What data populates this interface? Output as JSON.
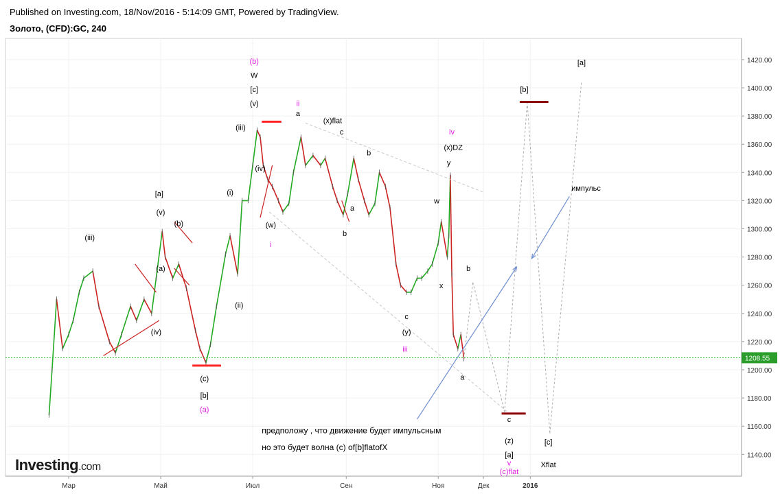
{
  "header": {
    "published": "Published on Investing.com, 18/Nov/2016 - 5:14:09 GMT, Powered by TradingView.",
    "symbol": "Золото, (CFD):GC, 240"
  },
  "logo": {
    "name": "Investing",
    "suffix": ".com"
  },
  "chart_data": {
    "type": "line",
    "ylim": [
      1130,
      1430
    ],
    "y_ticks": [
      1140,
      1160,
      1180,
      1200,
      1220,
      1240,
      1260,
      1280,
      1300,
      1320,
      1340,
      1360,
      1380,
      1400,
      1420
    ],
    "x_ticks": [
      "Мар",
      "Май",
      "Июл",
      "Сен",
      "Ноя",
      "Дек",
      "2016"
    ],
    "current_price": "1208.55",
    "colors": {
      "up": "#22aa22",
      "down": "#cc2222",
      "price_line": "#22bb22",
      "support": "#ff2222",
      "target": "#8b0000",
      "arrow": "#6f8fcf",
      "projection": "#aaaaaa",
      "magenta": "#e020e0"
    },
    "price_series": [
      {
        "x": "2016-02-17",
        "y": 1168
      },
      {
        "x": "2016-02-19",
        "y": 1200
      },
      {
        "x": "2016-02-22",
        "y": 1250
      },
      {
        "x": "2016-02-26",
        "y": 1215
      },
      {
        "x": "2016-03-01",
        "y": 1225
      },
      {
        "x": "2016-03-04",
        "y": 1235
      },
      {
        "x": "2016-03-08",
        "y": 1255
      },
      {
        "x": "2016-03-11",
        "y": 1265
      },
      {
        "x": "2016-03-17",
        "y": 1270
      },
      {
        "x": "2016-03-21",
        "y": 1245
      },
      {
        "x": "2016-03-28",
        "y": 1220
      },
      {
        "x": "2016-04-01",
        "y": 1212
      },
      {
        "x": "2016-04-05",
        "y": 1225
      },
      {
        "x": "2016-04-11",
        "y": 1245
      },
      {
        "x": "2016-04-15",
        "y": 1235
      },
      {
        "x": "2016-04-20",
        "y": 1250
      },
      {
        "x": "2016-04-25",
        "y": 1240
      },
      {
        "x": "2016-04-28",
        "y": 1265
      },
      {
        "x": "2016-05-02",
        "y": 1298
      },
      {
        "x": "2016-05-04",
        "y": 1280
      },
      {
        "x": "2016-05-09",
        "y": 1265
      },
      {
        "x": "2016-05-13",
        "y": 1275
      },
      {
        "x": "2016-05-18",
        "y": 1258
      },
      {
        "x": "2016-05-24",
        "y": 1228
      },
      {
        "x": "2016-05-27",
        "y": 1215
      },
      {
        "x": "2016-05-31",
        "y": 1205
      },
      {
        "x": "2016-06-03",
        "y": 1218
      },
      {
        "x": "2016-06-07",
        "y": 1245
      },
      {
        "x": "2016-06-13",
        "y": 1282
      },
      {
        "x": "2016-06-16",
        "y": 1295
      },
      {
        "x": "2016-06-21",
        "y": 1268
      },
      {
        "x": "2016-06-24",
        "y": 1320
      },
      {
        "x": "2016-06-28",
        "y": 1320
      },
      {
        "x": "2016-07-01",
        "y": 1345
      },
      {
        "x": "2016-07-04",
        "y": 1370
      },
      {
        "x": "2016-07-06",
        "y": 1365
      },
      {
        "x": "2016-07-08",
        "y": 1345
      },
      {
        "x": "2016-07-11",
        "y": 1335
      },
      {
        "x": "2016-07-14",
        "y": 1330
      },
      {
        "x": "2016-07-18",
        "y": 1320
      },
      {
        "x": "2016-07-21",
        "y": 1312
      },
      {
        "x": "2016-07-25",
        "y": 1318
      },
      {
        "x": "2016-07-28",
        "y": 1340
      },
      {
        "x": "2016-08-02",
        "y": 1365
      },
      {
        "x": "2016-08-05",
        "y": 1345
      },
      {
        "x": "2016-08-10",
        "y": 1352
      },
      {
        "x": "2016-08-15",
        "y": 1345
      },
      {
        "x": "2016-08-18",
        "y": 1350
      },
      {
        "x": "2016-08-23",
        "y": 1330
      },
      {
        "x": "2016-08-26",
        "y": 1320
      },
      {
        "x": "2016-08-30",
        "y": 1310
      },
      {
        "x": "2016-09-02",
        "y": 1325
      },
      {
        "x": "2016-09-06",
        "y": 1350
      },
      {
        "x": "2016-09-09",
        "y": 1335
      },
      {
        "x": "2016-09-13",
        "y": 1320
      },
      {
        "x": "2016-09-16",
        "y": 1310
      },
      {
        "x": "2016-09-20",
        "y": 1318
      },
      {
        "x": "2016-09-23",
        "y": 1340
      },
      {
        "x": "2016-09-27",
        "y": 1330
      },
      {
        "x": "2016-09-30",
        "y": 1315
      },
      {
        "x": "2016-10-04",
        "y": 1275
      },
      {
        "x": "2016-10-07",
        "y": 1260
      },
      {
        "x": "2016-10-11",
        "y": 1255
      },
      {
        "x": "2016-10-14",
        "y": 1255
      },
      {
        "x": "2016-10-18",
        "y": 1265
      },
      {
        "x": "2016-10-21",
        "y": 1265
      },
      {
        "x": "2016-10-25",
        "y": 1270
      },
      {
        "x": "2016-10-28",
        "y": 1275
      },
      {
        "x": "2016-11-01",
        "y": 1290
      },
      {
        "x": "2016-11-03",
        "y": 1305
      },
      {
        "x": "2016-11-07",
        "y": 1280
      },
      {
        "x": "2016-11-08",
        "y": 1295
      },
      {
        "x": "2016-11-09",
        "y": 1338
      },
      {
        "x": "2016-11-10",
        "y": 1268
      },
      {
        "x": "2016-11-11",
        "y": 1225
      },
      {
        "x": "2016-11-14",
        "y": 1215
      },
      {
        "x": "2016-11-16",
        "y": 1225
      },
      {
        "x": "2016-11-18",
        "y": 1208
      }
    ],
    "projection": [
      {
        "x": "2016-11-18",
        "y": 1208
      },
      {
        "x": "2016-11-24",
        "y": 1262
      },
      {
        "x": "2016-12-15",
        "y": 1170
      },
      {
        "x": "2016-12-30",
        "y": 1390
      },
      {
        "x": "2017-01-14",
        "y": 1155
      },
      {
        "x": "2017-02-04",
        "y": 1405
      }
    ],
    "triangle_lines": [
      {
        "from": {
          "x": "2016-08-05",
          "y": 1375
        },
        "to": {
          "x": "2016-12-01",
          "y": 1326
        }
      },
      {
        "from": {
          "x": "2016-07-12",
          "y": 1312
        },
        "to": {
          "x": "2016-12-17",
          "y": 1170
        }
      }
    ],
    "support_lines": [
      {
        "x1": "2016-07-07",
        "x2": "2016-07-20",
        "y": 1376
      },
      {
        "x1": "2016-05-22",
        "x2": "2016-06-10",
        "y": 1203
      }
    ],
    "target_lines": [
      {
        "x1": "2016-12-13",
        "x2": "2016-12-29",
        "y": 1169
      },
      {
        "x1": "2016-12-25",
        "x2": "2017-01-13",
        "y": 1390
      }
    ],
    "red_wedges": [
      {
        "from": {
          "x": "2016-03-24",
          "y": 1210
        },
        "to": {
          "x": "2016-04-30",
          "y": 1235
        }
      },
      {
        "from": {
          "x": "2016-04-14",
          "y": 1275
        },
        "to": {
          "x": "2016-04-28",
          "y": 1255
        }
      },
      {
        "from": {
          "x": "2016-05-10",
          "y": 1305
        },
        "to": {
          "x": "2016-05-22",
          "y": 1290
        }
      },
      {
        "from": {
          "x": "2016-05-10",
          "y": 1272
        },
        "to": {
          "x": "2016-05-20",
          "y": 1260
        }
      },
      {
        "from": {
          "x": "2016-07-06",
          "y": 1308
        },
        "to": {
          "x": "2016-07-14",
          "y": 1345
        }
      },
      {
        "from": {
          "x": "2016-08-29",
          "y": 1320
        },
        "to": {
          "x": "2016-09-03",
          "y": 1305
        }
      }
    ],
    "arrows": [
      {
        "from": {
          "x": "2016-10-18",
          "y": 1165
        },
        "to": {
          "x": "2016-12-23",
          "y": 1273
        }
      },
      {
        "from": {
          "x": "2017-01-27",
          "y": 1323
        },
        "to": {
          "x": "2017-01-02",
          "y": 1279
        }
      }
    ],
    "annotations": [
      {
        "text": "(b)",
        "x": "2016-07-02",
        "y": 1417,
        "color": "#e020e0"
      },
      {
        "text": "W",
        "x": "2016-07-02",
        "y": 1407,
        "color": "#000000"
      },
      {
        "text": "[c]",
        "x": "2016-07-02",
        "y": 1397,
        "color": "#000000"
      },
      {
        "text": "(v)",
        "x": "2016-07-02",
        "y": 1387,
        "color": "#000000"
      },
      {
        "text": "ii",
        "x": "2016-07-31",
        "y": 1387,
        "color": "#e020e0"
      },
      {
        "text": "a",
        "x": "2016-07-31",
        "y": 1380,
        "color": "#000000"
      },
      {
        "text": "(x)flat",
        "x": "2016-08-23",
        "y": 1375,
        "color": "#000000"
      },
      {
        "text": "c",
        "x": "2016-08-29",
        "y": 1367,
        "color": "#000000"
      },
      {
        "text": "b",
        "x": "2016-09-16",
        "y": 1352,
        "color": "#000000"
      },
      {
        "text": "iv",
        "x": "2016-11-10",
        "y": 1367,
        "color": "#e020e0"
      },
      {
        "text": "(x)DZ",
        "x": "2016-11-11",
        "y": 1356,
        "color": "#000000"
      },
      {
        "text": "y",
        "x": "2016-11-08",
        "y": 1345,
        "color": "#000000"
      },
      {
        "text": "w",
        "x": "2016-10-31",
        "y": 1318,
        "color": "#000000"
      },
      {
        "text": "a",
        "x": "2016-09-05",
        "y": 1313,
        "color": "#000000"
      },
      {
        "text": "b",
        "x": "2016-08-31",
        "y": 1295,
        "color": "#000000"
      },
      {
        "text": "(iii)",
        "x": "2016-06-23",
        "y": 1370,
        "color": "#000000"
      },
      {
        "text": "(i)",
        "x": "2016-06-16",
        "y": 1324,
        "color": "#000000"
      },
      {
        "text": "(iv)",
        "x": "2016-07-06",
        "y": 1341,
        "color": "#000000"
      },
      {
        "text": "(w)",
        "x": "2016-07-13",
        "y": 1301,
        "color": "#000000"
      },
      {
        "text": "i",
        "x": "2016-07-13",
        "y": 1287,
        "color": "#e020e0"
      },
      {
        "text": "(ii)",
        "x": "2016-06-22",
        "y": 1244,
        "color": "#000000"
      },
      {
        "text": "[a]",
        "x": "2016-04-30",
        "y": 1323,
        "color": "#000000"
      },
      {
        "text": "(v)",
        "x": "2016-05-01",
        "y": 1310,
        "color": "#000000"
      },
      {
        "text": "(b)",
        "x": "2016-05-13",
        "y": 1302,
        "color": "#000000"
      },
      {
        "text": "(a)",
        "x": "2016-05-01",
        "y": 1270,
        "color": "#000000"
      },
      {
        "text": "(iii)",
        "x": "2016-03-15",
        "y": 1292,
        "color": "#000000"
      },
      {
        "text": "(iv)",
        "x": "2016-04-28",
        "y": 1225,
        "color": "#000000"
      },
      {
        "text": "(c)",
        "x": "2016-05-30",
        "y": 1192,
        "color": "#000000"
      },
      {
        "text": "[b]",
        "x": "2016-05-30",
        "y": 1180,
        "color": "#000000"
      },
      {
        "text": "(a)",
        "x": "2016-05-30",
        "y": 1170,
        "color": "#e020e0"
      },
      {
        "text": "x",
        "x": "2016-11-03",
        "y": 1258,
        "color": "#000000"
      },
      {
        "text": "c",
        "x": "2016-10-11",
        "y": 1236,
        "color": "#000000"
      },
      {
        "text": "(y)",
        "x": "2016-10-11",
        "y": 1225,
        "color": "#000000"
      },
      {
        "text": "iii",
        "x": "2016-10-10",
        "y": 1213,
        "color": "#e020e0"
      },
      {
        "text": "a",
        "x": "2016-11-17",
        "y": 1193,
        "color": "#000000"
      },
      {
        "text": "b",
        "x": "2016-11-21",
        "y": 1270,
        "color": "#000000"
      },
      {
        "text": "c",
        "x": "2016-12-18",
        "y": 1163,
        "color": "#000000"
      },
      {
        "text": "(z)",
        "x": "2016-12-18",
        "y": 1148,
        "color": "#000000"
      },
      {
        "text": "[a]",
        "x": "2016-12-18",
        "y": 1138,
        "color": "#000000"
      },
      {
        "text": "v",
        "x": "2016-12-18",
        "y": 1132,
        "color": "#e020e0"
      },
      {
        "text": "(c)flat",
        "x": "2016-12-18",
        "y": 1126,
        "color": "#e020e0"
      },
      {
        "text": "[b]",
        "x": "2016-12-28",
        "y": 1397,
        "color": "#000000"
      },
      {
        "text": "[c]",
        "x": "2017-01-13",
        "y": 1147,
        "color": "#000000"
      },
      {
        "text": "Xflat",
        "x": "2017-01-13",
        "y": 1131,
        "color": "#000000"
      },
      {
        "text": "[a]",
        "x": "2017-02-04",
        "y": 1416,
        "color": "#000000"
      },
      {
        "text": "импульс",
        "x": "2017-02-07",
        "y": 1327,
        "color": "#000000"
      },
      {
        "text": "предположу , что движение будет импульсным",
        "x": "2016-07-07",
        "y": 1155,
        "color": "#000000"
      },
      {
        "text": "но это будет волна (c) of[b]flatofX",
        "x": "2016-07-07",
        "y": 1143,
        "color": "#000000"
      }
    ]
  }
}
